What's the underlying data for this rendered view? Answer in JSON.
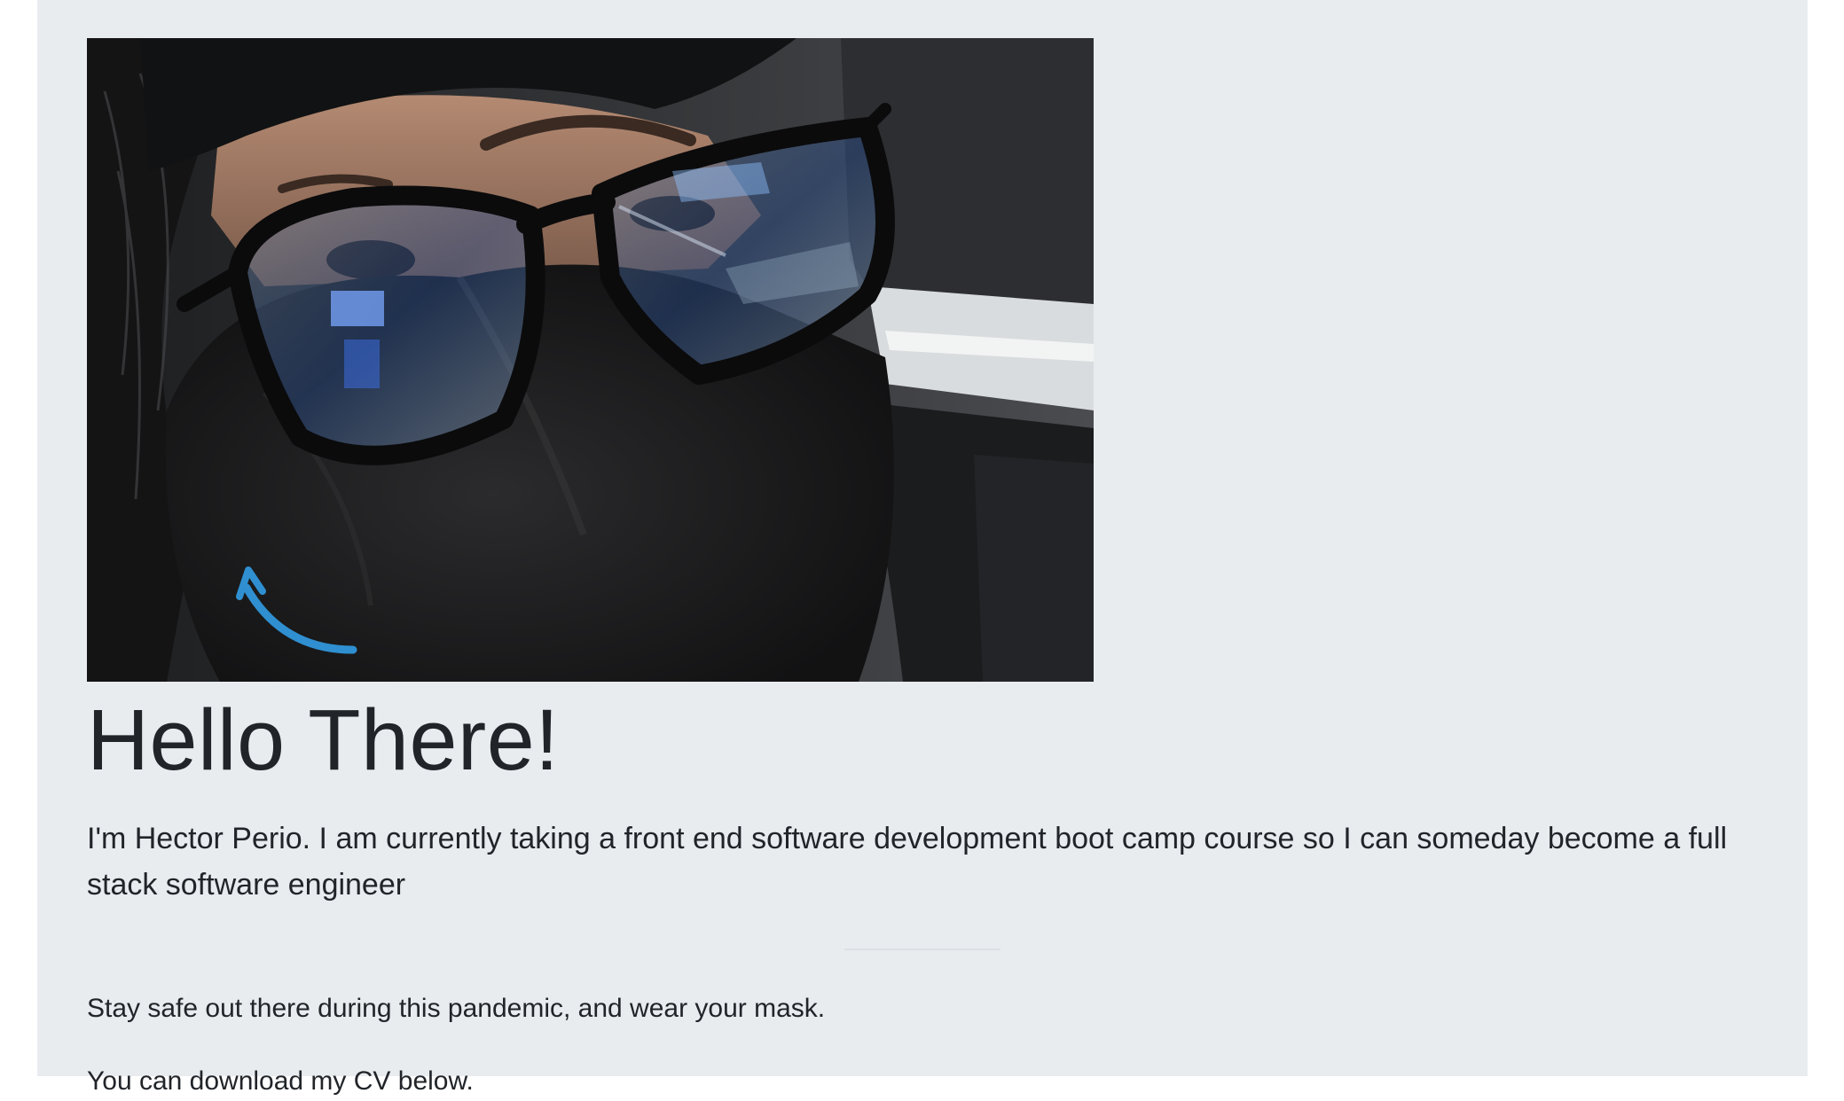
{
  "jumbotron": {
    "heading": "Hello There!",
    "lead": "I'm Hector Perio. I am currently taking a front end software development boot camp course so I can someday become a full stack software engineer",
    "message": "Stay safe out there during this pandemic, and wear your mask.",
    "cv_text": "You can download my CV below."
  },
  "colors": {
    "page_background": "#ffffff",
    "jumbotron_background": "#e9ecef",
    "text": "#212529",
    "divider": "#dcdfe3"
  }
}
